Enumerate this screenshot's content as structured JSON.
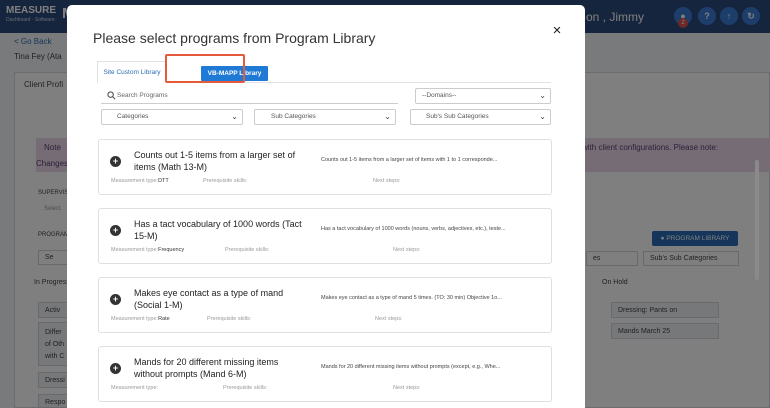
{
  "app": {
    "brand": "MEASURE",
    "brand_tail": "M",
    "brand_sub": "Dashboard · Software",
    "user_name": "on , Jimmy",
    "notif_count": "2",
    "back_link": "< Go Back",
    "client_name": "Tina Fey (Ata",
    "client_profile_tab": "Client Profi",
    "note_left_1": "Note",
    "note_left_2": "Changes",
    "note_right": "with client configurations. Please note:",
    "supervisor_label": "SUPERVIS",
    "supervisor_value": "Select",
    "programs_label": "PROGRAM",
    "search_label": "Se",
    "program_library_btn": "PROGRAM LIBRARY",
    "bg_sub_select": "es",
    "bg_subsub_select": "Sub's Sub Categories",
    "in_progress_label": "In Progress",
    "on_hold_label": "On Hold",
    "left_items": [
      "Activ",
      "Differ",
      "of Oth",
      "with C",
      "Dressi",
      "Respo"
    ],
    "on_hold_items": [
      "Dressing: Pants on",
      "Mands March 25"
    ]
  },
  "modal": {
    "title": "Please select programs from Program Library",
    "close_label": "×",
    "tabs": [
      {
        "label": "Site Custom Library"
      },
      {
        "label": "VB-MAPP Library"
      }
    ],
    "search": {
      "placeholder": "Search Programs",
      "value": ""
    },
    "filters": {
      "domains": "--Domains--",
      "categories": "Categories",
      "sub_categories": "Sub Categories",
      "subsub_categories": "Sub's Sub Categories"
    },
    "field_labels": {
      "measurement": "Measurement type:",
      "prerequisite": "Prerequisite skills:",
      "next_steps": "Next steps:"
    },
    "programs": [
      {
        "title": "Counts out 1-5 items from a larger set of items (Math 13-M)",
        "description": "Counts out 1-5 items from a larger set of items with 1 to 1 corresponde...",
        "measurement_value": "DTT"
      },
      {
        "title": "Has a tact vocabulary of 1000 words (Tact 15-M)",
        "description": "Has a tact vocabulary of 1000 words (nouns, verbs, adjectives, etc.), teste...",
        "measurement_value": "Frequency"
      },
      {
        "title": "Makes eye contact as a type of mand (Social 1-M)",
        "description": "Makes eye contact as a type of mand 5 times. (TO: 30 min) Objective 1o...",
        "measurement_value": "Rate"
      },
      {
        "title": "Mands for 20 different missing items without prompts (Mand 6-M)",
        "description": "Mands for 20 different missing items without prompts (except, e.g., Whe...",
        "measurement_value": ""
      }
    ]
  },
  "colors": {
    "topbar": "#2c4a7c",
    "active_tab": "#1f7ad6",
    "highlight_box": "#e45a3b",
    "library_button": "#2a6db5"
  }
}
